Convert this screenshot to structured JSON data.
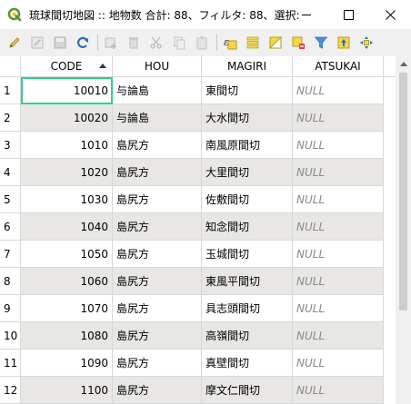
{
  "window": {
    "title": "琉球間切地図 :: 地物数 合計: 88、フィルタ: 88、選択: 0",
    "minimize_glyph": "—",
    "close_glyph": "✕"
  },
  "toolbar": {
    "items": [
      {
        "icon": "pencil-edit-icon",
        "enabled": true
      },
      {
        "icon": "multi-edit-icon",
        "enabled": false
      },
      {
        "icon": "save-edits-icon",
        "enabled": false
      },
      {
        "icon": "reload-icon",
        "enabled": true
      },
      {
        "icon": "add-feature-icon",
        "enabled": false
      },
      {
        "icon": "delete-feature-icon",
        "enabled": false
      },
      {
        "icon": "cut-icon",
        "enabled": false
      },
      {
        "icon": "copy-icon",
        "enabled": false
      },
      {
        "icon": "paste-icon",
        "enabled": false
      },
      {
        "icon": "expression-select-icon",
        "enabled": true
      },
      {
        "icon": "select-all-icon",
        "enabled": true
      },
      {
        "icon": "invert-selection-icon",
        "enabled": true
      },
      {
        "icon": "deselect-all-icon",
        "enabled": true
      },
      {
        "icon": "filter-icon",
        "enabled": true
      },
      {
        "icon": "move-selection-top-icon",
        "enabled": true
      },
      {
        "icon": "pan-to-selection-icon",
        "enabled": true
      }
    ]
  },
  "table": {
    "columns": [
      "CODE",
      "HOU",
      "MAGIRI",
      "ATSUKAI"
    ],
    "sorted_column": "CODE",
    "sort_direction": "ascending",
    "null_text": "NULL",
    "rows": [
      {
        "n": "1",
        "code": "10010",
        "hou": "与論島",
        "magiri": "東間切",
        "atsukai": "NULL"
      },
      {
        "n": "2",
        "code": "10020",
        "hou": "与論島",
        "magiri": "大水間切",
        "atsukai": "NULL"
      },
      {
        "n": "3",
        "code": "1010",
        "hou": "島尻方",
        "magiri": "南風原間切",
        "atsukai": "NULL"
      },
      {
        "n": "4",
        "code": "1020",
        "hou": "島尻方",
        "magiri": "大里間切",
        "atsukai": "NULL"
      },
      {
        "n": "5",
        "code": "1030",
        "hou": "島尻方",
        "magiri": "佐敷間切",
        "atsukai": "NULL"
      },
      {
        "n": "6",
        "code": "1040",
        "hou": "島尻方",
        "magiri": "知念間切",
        "atsukai": "NULL"
      },
      {
        "n": "7",
        "code": "1050",
        "hou": "島尻方",
        "magiri": "玉城間切",
        "atsukai": "NULL"
      },
      {
        "n": "8",
        "code": "1060",
        "hou": "島尻方",
        "magiri": "東風平間切",
        "atsukai": "NULL"
      },
      {
        "n": "9",
        "code": "1070",
        "hou": "島尻方",
        "magiri": "具志頭間切",
        "atsukai": "NULL"
      },
      {
        "n": "10",
        "code": "1080",
        "hou": "島尻方",
        "magiri": "高嶺間切",
        "atsukai": "NULL"
      },
      {
        "n": "11",
        "code": "1090",
        "hou": "島尻方",
        "magiri": "真壁間切",
        "atsukai": "NULL"
      },
      {
        "n": "12",
        "code": "1100",
        "hou": "島尻方",
        "magiri": "摩文仁間切",
        "atsukai": "NULL"
      }
    ]
  },
  "colors": {
    "selection_border": "#2fd28a",
    "alt_row": "#e9e7e3",
    "null_text": "#8a8a8a",
    "qgis_green": "#589632"
  }
}
